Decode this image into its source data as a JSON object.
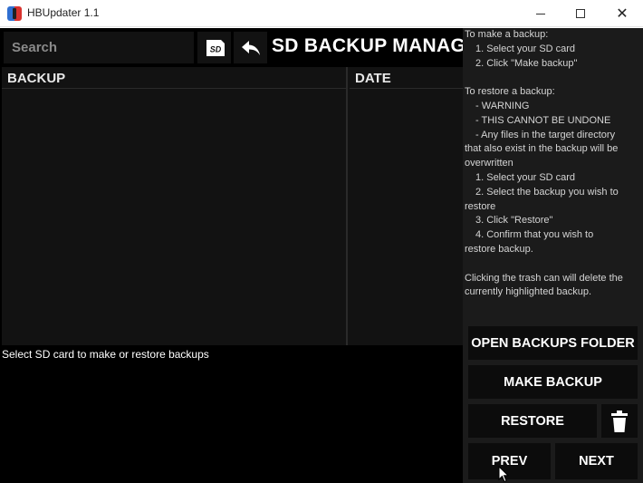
{
  "window": {
    "title": "HBUpdater 1.1",
    "close_glyph": "✕"
  },
  "search": {
    "placeholder": "Search"
  },
  "sd_button": {
    "label": "SD"
  },
  "header": {
    "title": "SD BACKUP MANAGER"
  },
  "table": {
    "columns": [
      "BACKUP",
      "DATE"
    ],
    "rows": []
  },
  "status": {
    "text": "Select SD card to make or restore backups"
  },
  "instructions": {
    "lines": [
      "To make a backup:",
      "1. Select your SD card",
      "2. Click \"Make backup\"",
      "",
      "To restore a backup:",
      "- WARNING",
      "- THIS CANNOT BE UNDONE",
      "- Any files in the target directory",
      "that also exist in the backup will be",
      "overwritten",
      "1. Select your SD card",
      "2. Select the backup you wish to",
      "restore",
      "3. Click \"Restore\"",
      "4. Confirm that you wish to",
      "restore backup.",
      "",
      "Clicking the trash can will delete the",
      "currently highlighted backup."
    ]
  },
  "buttons": {
    "open_backups_folder": "OPEN BACKUPS FOLDER",
    "make_backup": "MAKE BACKUP",
    "restore": "RESTORE",
    "prev": "PREV",
    "next": "NEXT"
  },
  "icons": {
    "app": "joycon-icon",
    "sd": "sd-card-icon",
    "back": "back-arrow-icon",
    "trash": "trash-icon"
  },
  "colors": {
    "background": "#000000",
    "panel": "#121212",
    "sidebar": "#1b1b1b",
    "button": "#0c0c0c",
    "text": "#ffffff",
    "app_icon_left": "#2f6fd1",
    "app_icon_right": "#d9332f"
  }
}
